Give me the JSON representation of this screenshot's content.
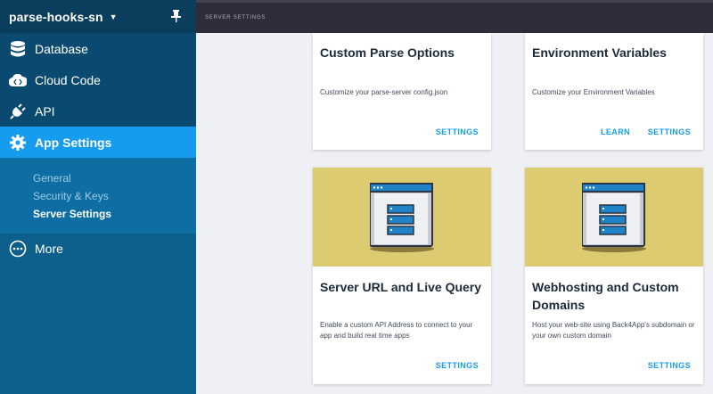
{
  "app": {
    "name": "parse-hooks-sn"
  },
  "topbar": {
    "breadcrumb": "SERVER SETTINGS"
  },
  "sidebar": {
    "items": [
      {
        "label": "Database"
      },
      {
        "label": "Cloud Code"
      },
      {
        "label": "API"
      },
      {
        "label": "App Settings"
      },
      {
        "label": "More"
      }
    ],
    "subitems": [
      {
        "label": "General"
      },
      {
        "label": "Security & Keys"
      },
      {
        "label": "Server Settings"
      }
    ]
  },
  "cards": [
    {
      "title": "Custom Parse Options",
      "desc": "Customize your parse-server config.json",
      "actions": [
        "SETTINGS"
      ]
    },
    {
      "title": "Environment Variables",
      "desc": "Customize your Environment Variables",
      "actions": [
        "LEARN",
        "SETTINGS"
      ]
    },
    {
      "title": "Server URL and Live Query",
      "desc": "Enable a custom API Address to connect to your app and build real time apps",
      "actions": [
        "SETTINGS"
      ]
    },
    {
      "title": "Webhosting and Custom Domains",
      "desc": "Host your web-site using Back4App's subdomain or your own custom domain",
      "actions": [
        "SETTINGS"
      ]
    }
  ],
  "colors": {
    "accent": "#169cee",
    "sidebar": "#0d5f8c",
    "sidebar_dark": "#0b3d5c",
    "card_image": "#ddcb72"
  }
}
